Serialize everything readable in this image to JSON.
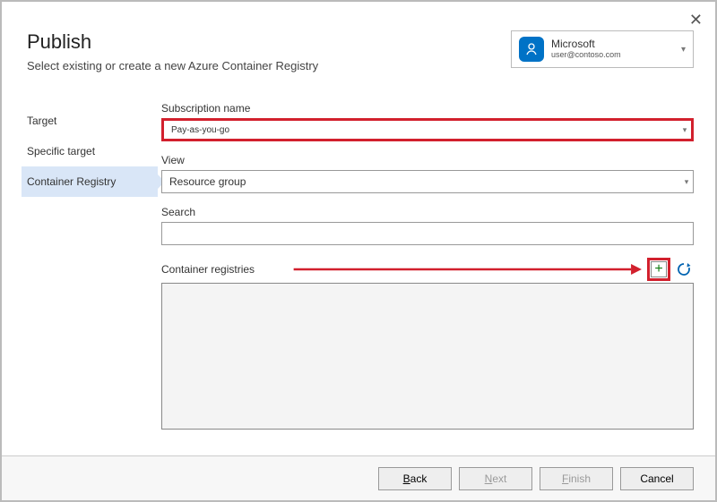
{
  "window": {
    "close_glyph": "✕"
  },
  "header": {
    "title": "Publish",
    "subtitle": "Select existing or create a new Azure Container Registry"
  },
  "account": {
    "name": "Microsoft",
    "email": "user@contoso.com"
  },
  "sidebar": {
    "items": [
      {
        "label": "Target",
        "selected": false
      },
      {
        "label": "Specific target",
        "selected": false
      },
      {
        "label": "Container Registry",
        "selected": true
      }
    ]
  },
  "form": {
    "subscription": {
      "label": "Subscription name",
      "value": "Pay-as-you-go"
    },
    "view": {
      "label": "View",
      "value": "Resource group"
    },
    "search": {
      "label": "Search",
      "value": ""
    },
    "registries": {
      "label": "Container registries"
    }
  },
  "footer": {
    "back": "Back",
    "next": "Next",
    "finish": "Finish",
    "cancel": "Cancel"
  }
}
